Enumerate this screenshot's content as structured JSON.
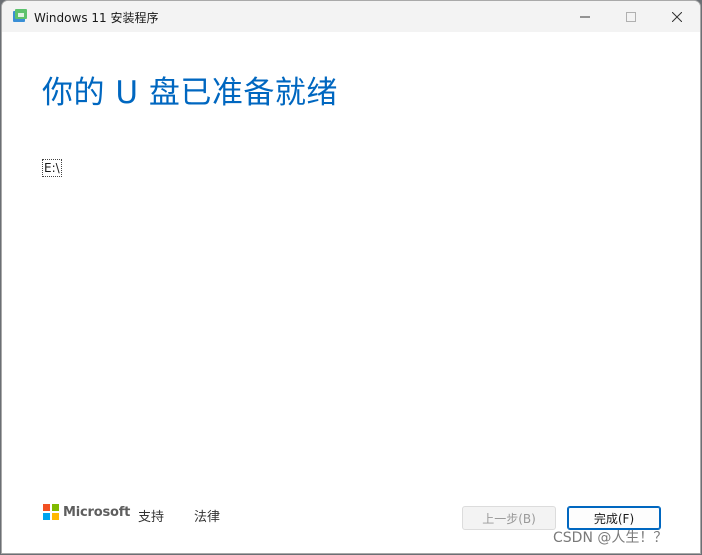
{
  "window": {
    "title": "Windows 11 安装程序",
    "controls": {
      "minimize": "minimize-icon",
      "maximize": "maximize-icon",
      "close": "close-icon"
    }
  },
  "main": {
    "heading": "你的 U 盘已准备就绪",
    "drive_label": "E:\\"
  },
  "footer": {
    "brand": "Microsoft",
    "support_link": "支持",
    "legal_link": "法律",
    "back_button": "上一步(B)",
    "finish_button": "完成(F)"
  },
  "overlay": {
    "watermark": "CSDN @人生！？"
  },
  "colors": {
    "accent": "#0067c0",
    "ms_red": "#f25022",
    "ms_green": "#7fba00",
    "ms_blue": "#00a4ef",
    "ms_yellow": "#ffb900"
  }
}
